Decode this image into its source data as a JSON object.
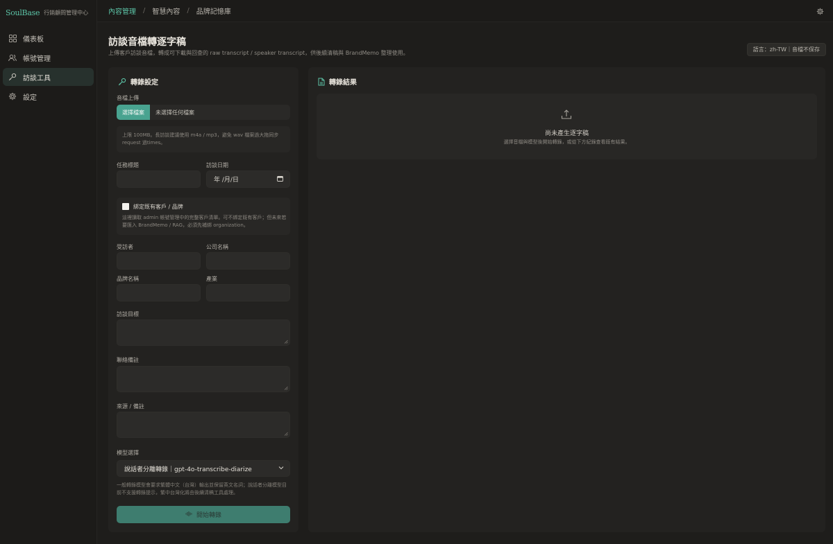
{
  "brand": {
    "logo": "SoulBase",
    "subtitle": "行銷顧問管理中心"
  },
  "sidebar": {
    "items": [
      {
        "label": "儀表板",
        "icon": "grid-icon",
        "active": false
      },
      {
        "label": "帳號管理",
        "icon": "users-icon",
        "active": false
      },
      {
        "label": "訪談工具",
        "icon": "microphone-icon",
        "active": true
      },
      {
        "label": "設定",
        "icon": "gear-icon",
        "active": false
      }
    ]
  },
  "topbar": {
    "breadcrumbs": [
      "內容管理",
      "智慧內容",
      "品牌記憶庫"
    ],
    "separator": "/"
  },
  "page": {
    "title": "訪談音檔轉逐字稿",
    "description": "上傳客戶訪談音檔，轉成可下載與回查的 raw transcript / speaker transcript，供後續清稿與 BrandMemo 整理使用。",
    "lang_badge": "語言：zh-TW｜音檔不保存"
  },
  "settings_panel": {
    "title": "轉錄設定",
    "upload_label": "音檔上傳",
    "file_button": "選擇檔案",
    "file_status": "未選擇任何檔案",
    "upload_hint": "上限 100MB。長訪談建議使用 m4a / mp3，避免 wav 檔案過大拖同步 request 過times。",
    "task_title_label": "任務標題",
    "task_title_value": "",
    "interview_date_label": "訪談日期",
    "interview_date_placeholder": "年 /月/日",
    "bind_checkbox_label": "綁定既有客戶 / 品牌",
    "bind_checkbox_checked": false,
    "bind_help": "這裡讀取 admin 帳號管理中的完整客戶清單。可不綁定既有客戶；但未來若要匯入 BrandMemo / RAG，必須先補綁 organization。",
    "interviewee_label": "受訪者",
    "company_label": "公司名稱",
    "brand_label": "品牌名稱",
    "industry_label": "產業",
    "goal_label": "訪談目標",
    "notes_label": "聯絡備註",
    "source_label": "來源 / 備註",
    "model_label": "模型選擇",
    "model_value": "說話者分離轉錄｜gpt-4o-transcribe-diarize",
    "model_help": "一般轉錄模型會要求繁體中文（台灣）輸出並保留英文名詞；說話者分離模型目前不支援轉錄提示，繁中台灣化將由後續清稿工具處理。",
    "start_button": "開始轉錄"
  },
  "result_panel": {
    "title": "轉錄結果",
    "empty_title": "尚未產生逐字稿",
    "empty_subtitle": "選擇音檔與模型後開始轉錄，或從下方紀錄查看既有結果。"
  },
  "colors": {
    "accent": "#5cc3a6",
    "button": "#3e7d6f",
    "background": "#1e1d1b",
    "panel": "#232220"
  }
}
